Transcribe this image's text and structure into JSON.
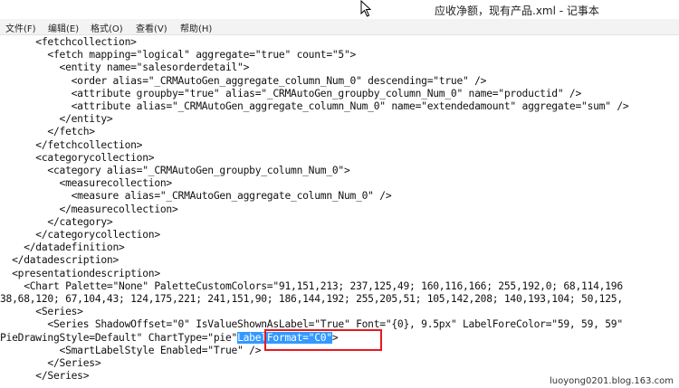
{
  "window": {
    "title": "应收净额，现有产品.xml - 记事本"
  },
  "menu": {
    "items": [
      "文件(F)",
      "编辑(E)",
      "格式(O)",
      "查看(V)",
      "帮助(H)"
    ]
  },
  "editor": {
    "lines": [
      "      <fetchcollection>",
      "        <fetch mapping=\"logical\" aggregate=\"true\" count=\"5\">",
      "          <entity name=\"salesorderdetail\">",
      "            <order alias=\"_CRMAutoGen_aggregate_column_Num_0\" descending=\"true\" />",
      "            <attribute groupby=\"true\" alias=\"_CRMAutoGen_groupby_column_Num_0\" name=\"productid\" />",
      "            <attribute alias=\"_CRMAutoGen_aggregate_column_Num_0\" name=\"extendedamount\" aggregate=\"sum\" />",
      "          </entity>",
      "        </fetch>",
      "      </fetchcollection>",
      "      <categorycollection>",
      "        <category alias=\"_CRMAutoGen_groupby_column_Num_0\">",
      "          <measurecollection>",
      "            <measure alias=\"_CRMAutoGen_aggregate_column_Num_0\" />",
      "          </measurecollection>",
      "        </category>",
      "      </categorycollection>",
      "    </datadefinition>",
      "  </datadescription>",
      "  <presentationdescription>",
      "    <Chart Palette=\"None\" PaletteCustomColors=\"91,151,213; 237,125,49; 160,116,166; 255,192,0; 68,114,196",
      "38,68,120; 67,104,43; 124,175,221; 241,151,90; 186,144,192; 255,205,51; 105,142,208; 140,193,104; 50,125,",
      "      <Series>",
      "        <Series ShadowOffset=\"0\" IsValueShownAsLabel=\"True\" Font=\"{0}, 9.5px\" LabelForeColor=\"59, 59, 59\"",
      "PieDrawingStyle=Default\" ChartType=\"pie\"",
      "          <SmartLabelStyle Enabled=\"True\" />",
      "        </Series>",
      "      </Series>"
    ],
    "selected_text": "LabelFormat=\"C0\"",
    "selected_text_close": ">"
  },
  "watermark": {
    "text": "luoyong0201.blog.163.com"
  },
  "colors": {
    "selection": "#3399ff",
    "highlight_box": "#e8181e",
    "menubar_bg": "#f3f3f3"
  }
}
